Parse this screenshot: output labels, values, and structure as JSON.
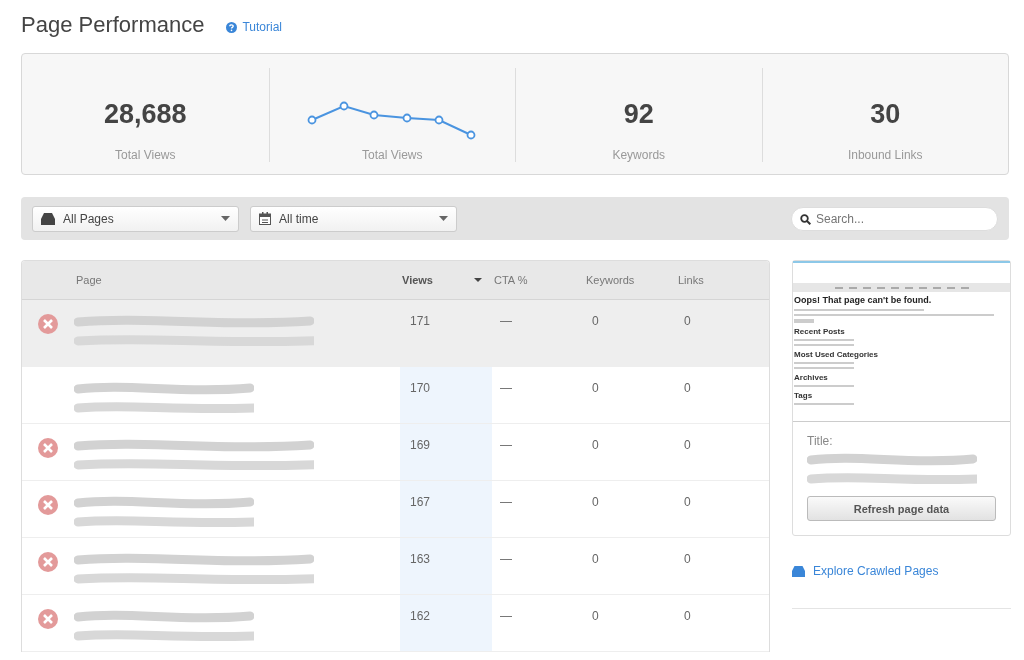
{
  "header": {
    "title": "Page Performance",
    "tutorial_link": "Tutorial"
  },
  "stats": [
    {
      "kind": "number",
      "value": "28,688",
      "label": "Total Views"
    },
    {
      "kind": "sparkline",
      "label": "Total Views"
    },
    {
      "kind": "number",
      "value": "92",
      "label": "Keywords"
    },
    {
      "kind": "number",
      "value": "30",
      "label": "Inbound Links"
    }
  ],
  "filters": {
    "pages_dropdown": "All Pages",
    "time_dropdown": "All time",
    "search": {
      "placeholder": "Search..."
    }
  },
  "table": {
    "columns": [
      {
        "label": "Page",
        "sorted": false
      },
      {
        "label": "Views",
        "sorted": true
      },
      {
        "label": "CTA %",
        "sorted": false
      },
      {
        "label": "Keywords",
        "sorted": false
      },
      {
        "label": "Links",
        "sorted": false
      }
    ],
    "rows": [
      {
        "selected": true,
        "error": true,
        "views": "171",
        "cta": "—",
        "keywords": "0",
        "links": "0"
      },
      {
        "selected": false,
        "error": false,
        "views": "170",
        "cta": "—",
        "keywords": "0",
        "links": "0"
      },
      {
        "selected": false,
        "error": true,
        "views": "169",
        "cta": "—",
        "keywords": "0",
        "links": "0"
      },
      {
        "selected": false,
        "error": true,
        "views": "167",
        "cta": "—",
        "keywords": "0",
        "links": "0"
      },
      {
        "selected": false,
        "error": true,
        "views": "163",
        "cta": "—",
        "keywords": "0",
        "links": "0"
      },
      {
        "selected": false,
        "error": true,
        "views": "162",
        "cta": "—",
        "keywords": "0",
        "links": "0"
      }
    ]
  },
  "preview": {
    "page_heading": "Oops! That page can't be found.",
    "sections": [
      "Recent Posts",
      "Most Used Categories",
      "Archives",
      "Tags"
    ],
    "title_label": "Title:",
    "refresh_button": "Refresh page data"
  },
  "explore_link": "Explore Crawled Pages"
}
